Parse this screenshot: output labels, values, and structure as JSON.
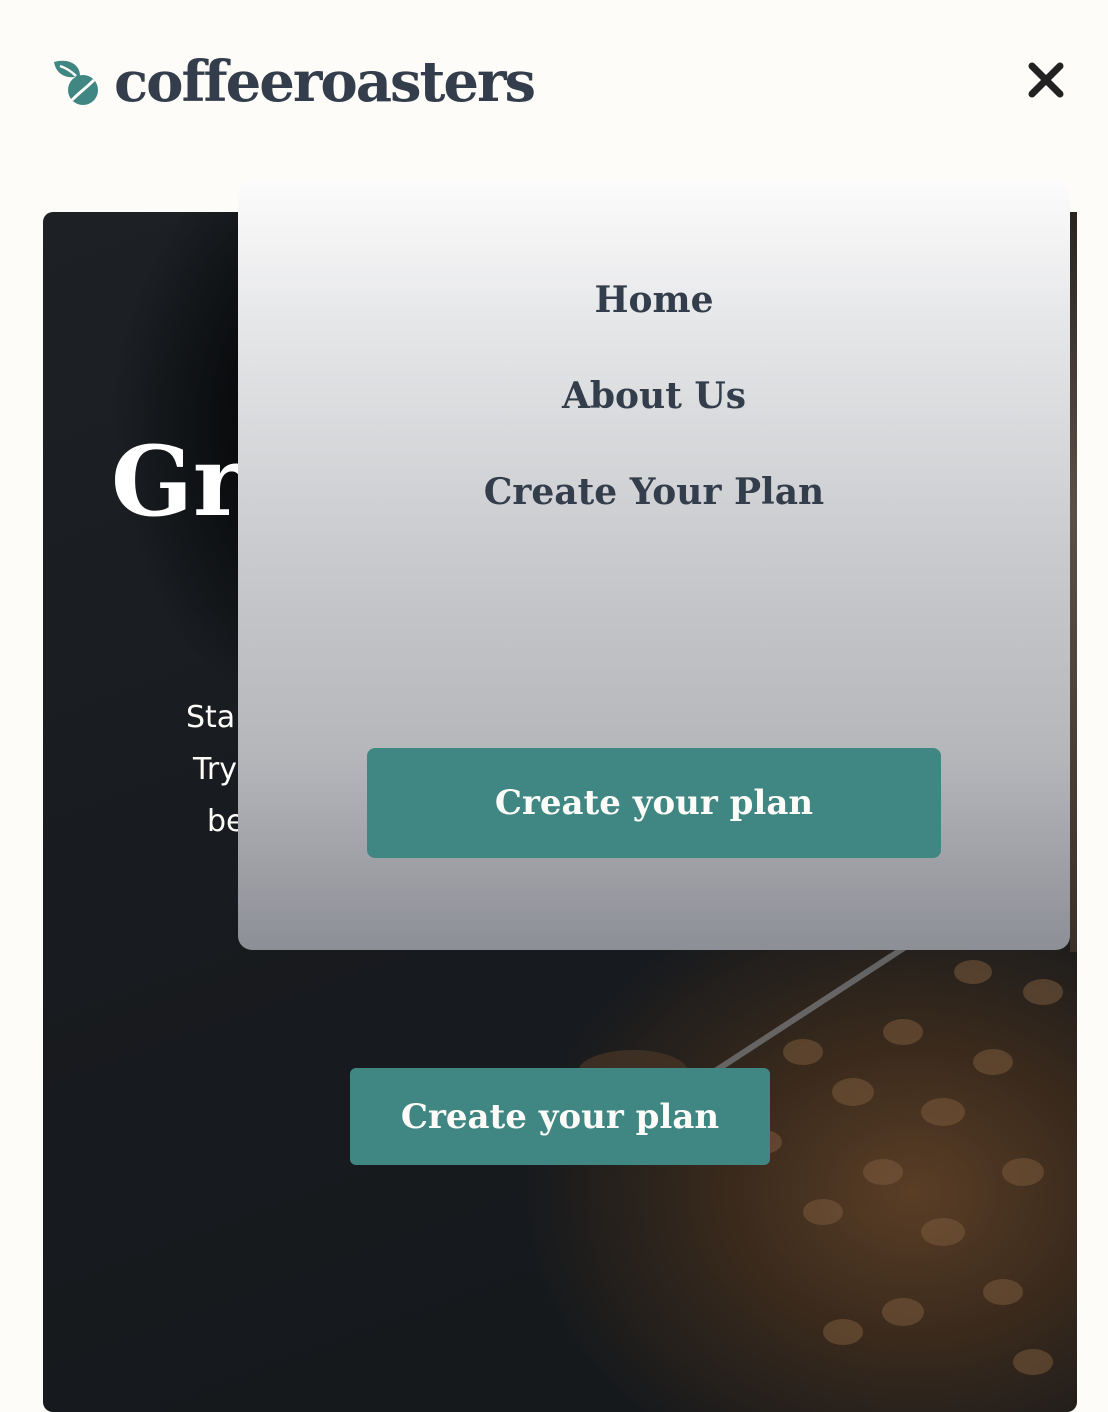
{
  "header": {
    "logo_text": "coffeeroasters",
    "logo_icon": "coffee-bean-leaf-icon",
    "close_icon": "close-icon"
  },
  "hero": {
    "title": "Gr",
    "text_lines": [
      "Sta",
      "Try",
      "be"
    ],
    "cta_label": "Create your plan"
  },
  "menu": {
    "items": [
      {
        "label": "Home"
      },
      {
        "label": "About Us"
      },
      {
        "label": "Create Your Plan"
      }
    ],
    "cta_label": "Create your plan"
  },
  "colors": {
    "accent": "#408783",
    "text_dark": "#333d4b",
    "background": "#fdfcf8"
  }
}
